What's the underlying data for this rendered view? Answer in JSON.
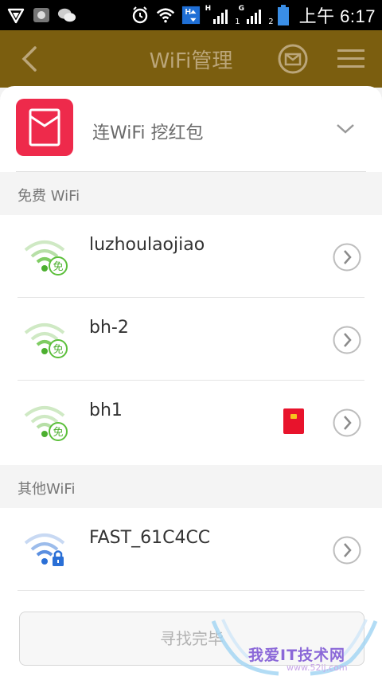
{
  "status_bar": {
    "time": "上午 6:17",
    "signal1_label": "H",
    "signal1_sub": "1",
    "signal2_label": "G",
    "signal2_sub": "2"
  },
  "header": {
    "title": "WiFi管理"
  },
  "panel": {
    "title": "连WiFi 挖红包"
  },
  "free_section": {
    "label": "免费 WiFi",
    "networks": [
      {
        "ssid": "luzhoulaojiao",
        "badge": "免"
      },
      {
        "ssid": "bh-2",
        "badge": "免"
      },
      {
        "ssid": "bh1",
        "badge": "免"
      }
    ]
  },
  "other_section": {
    "label": "其他WiFi",
    "networks": [
      {
        "ssid": "FAST_61C4CC"
      }
    ]
  },
  "find_button": {
    "label": "寻找完毕"
  },
  "watermark": {
    "title": "我爱IT技术网",
    "url": "www.52ij.com"
  },
  "colors": {
    "accent_red": "#ee2a4b",
    "free_green": "#5bbf3a",
    "secure_blue": "#2a6fd6",
    "header_dim": "#7b5e0f"
  }
}
